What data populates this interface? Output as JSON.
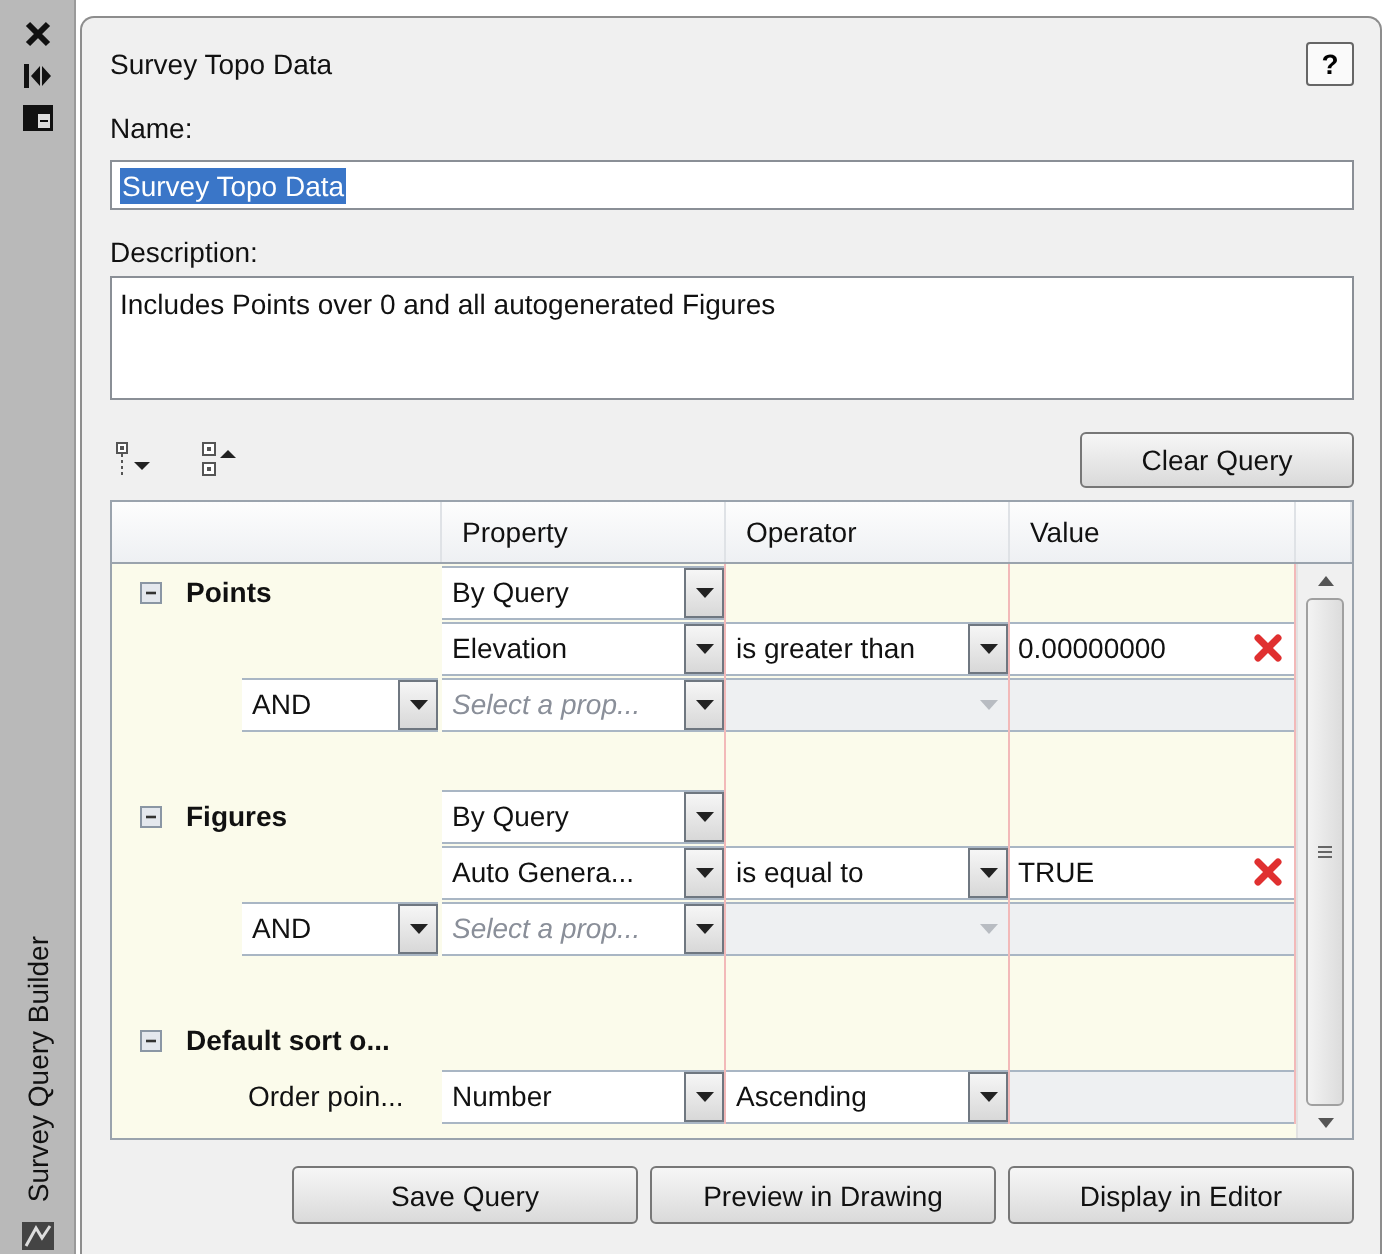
{
  "sidebar": {
    "title": "Survey Query Builder"
  },
  "dialog": {
    "title": "Survey Topo Data",
    "help": "?"
  },
  "name": {
    "label": "Name:",
    "value": "Survey Topo Data",
    "selected": true
  },
  "description": {
    "label": "Description:",
    "value": "Includes Points over 0 and all autogenerated Figures"
  },
  "clear_button": "Clear Query",
  "table": {
    "columns": [
      "Property",
      "Operator",
      "Value"
    ],
    "rows": [
      {
        "kind": "group",
        "label": "Points",
        "expanded": true,
        "property": "By Query"
      },
      {
        "kind": "condition",
        "property": "Elevation",
        "operator": "is greater than",
        "value": "0.00000000"
      },
      {
        "kind": "join",
        "join": "AND",
        "placeholder": "Select a prop..."
      },
      {
        "kind": "spacer"
      },
      {
        "kind": "group",
        "label": "Figures",
        "expanded": true,
        "property": "By Query"
      },
      {
        "kind": "condition",
        "property": "Auto Genera...",
        "operator": "is equal to",
        "value": "TRUE"
      },
      {
        "kind": "join",
        "join": "AND",
        "placeholder": "Select a prop..."
      },
      {
        "kind": "spacer"
      },
      {
        "kind": "group",
        "label": "Default sort o...",
        "expanded": true
      },
      {
        "kind": "sort",
        "label": "Order poin...",
        "property": "Number",
        "operator": "Ascending"
      }
    ]
  },
  "buttons": [
    "Save Query",
    "Preview in Drawing",
    "Display in Editor"
  ]
}
